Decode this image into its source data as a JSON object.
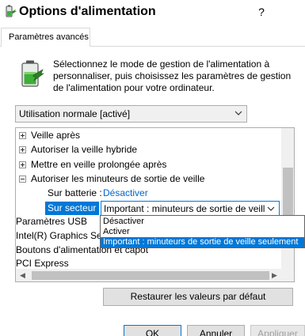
{
  "window": {
    "title": "Options d'alimentation",
    "help_label": "?"
  },
  "tabs": [
    {
      "label": "Paramètres avancés"
    }
  ],
  "description": "Sélectionnez le mode de gestion de l'alimentation à personnaliser, puis choisissez les paramètres de gestion de l'alimentation pour votre ordinateur.",
  "plan_select": {
    "value": "Utilisation normale [activé]"
  },
  "tree": {
    "items": [
      {
        "label": "Veille après",
        "expander": "plus"
      },
      {
        "label": "Autoriser la veille hybride",
        "expander": "plus"
      },
      {
        "label": "Mettre en veille prolongée après",
        "expander": "plus"
      },
      {
        "label": "Autoriser les minuteurs de sortie de veille",
        "expander": "minus"
      },
      {
        "label": "Paramètres USB",
        "expander": "plus"
      },
      {
        "label": "Intel(R) Graphics Settings",
        "expander": "plus"
      },
      {
        "label": "Boutons d'alimentation et capot",
        "expander": "plus"
      },
      {
        "label": "PCI Express",
        "expander": "plus"
      }
    ],
    "battery": {
      "label": "Sur batterie :",
      "value": "Désactiver"
    },
    "ac": {
      "label": "Sur secteur :",
      "value": "Important : minuteurs de sortie de veill"
    }
  },
  "dropdown": {
    "options": [
      {
        "label": "Désactiver"
      },
      {
        "label": "Activer"
      },
      {
        "label": "Important : minuteurs de sortie de veille seulement"
      }
    ],
    "selected_index": 2
  },
  "buttons": {
    "restore": "Restaurer les valeurs par défaut",
    "ok": "OK",
    "cancel": "Annuler",
    "apply": "Appliquer"
  },
  "colors": {
    "accent": "#0078d7",
    "link": "#0066cc"
  }
}
